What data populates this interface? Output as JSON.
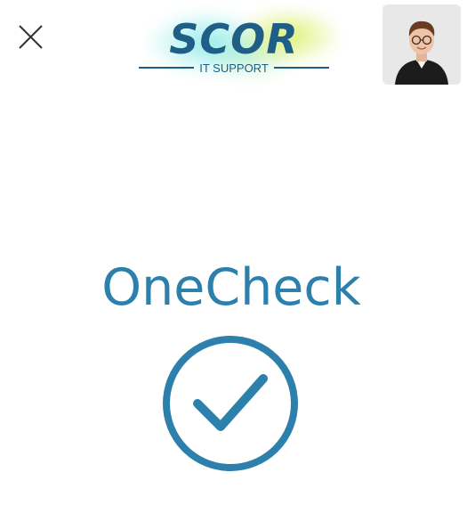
{
  "header": {
    "close_icon": "close-icon",
    "logo": {
      "word": "SCOR",
      "subtitle": "IT SUPPORT",
      "color": "#1f5e86"
    },
    "avatar_icon": "user-avatar"
  },
  "main": {
    "title": "OneCheck",
    "status_icon": "check-circle-icon",
    "accent_color": "#2c80ab"
  }
}
